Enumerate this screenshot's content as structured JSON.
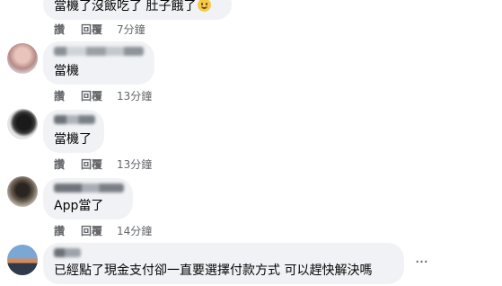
{
  "comments": [
    {
      "text": "當機了沒飯吃了 肚子餓了",
      "emoji": "smiling-face",
      "actions": {
        "like": "讚",
        "reply": "回覆",
        "time": "7分鐘"
      }
    },
    {
      "text": "當機",
      "actions": {
        "like": "讚",
        "reply": "回覆",
        "time": "13分鐘"
      }
    },
    {
      "text": "當機了",
      "actions": {
        "like": "讚",
        "reply": "回覆",
        "time": "13分鐘"
      }
    },
    {
      "text": "App當了",
      "actions": {
        "like": "讚",
        "reply": "回覆",
        "time": "14分鐘"
      }
    },
    {
      "text": "已經點了現金支付卻一直要選擇付款方式 可以趕快解決嗎",
      "more_label": "···"
    }
  ],
  "colors": {
    "bubble": "#f0f2f5",
    "meta_text": "#65676b",
    "body_text": "#050505"
  }
}
